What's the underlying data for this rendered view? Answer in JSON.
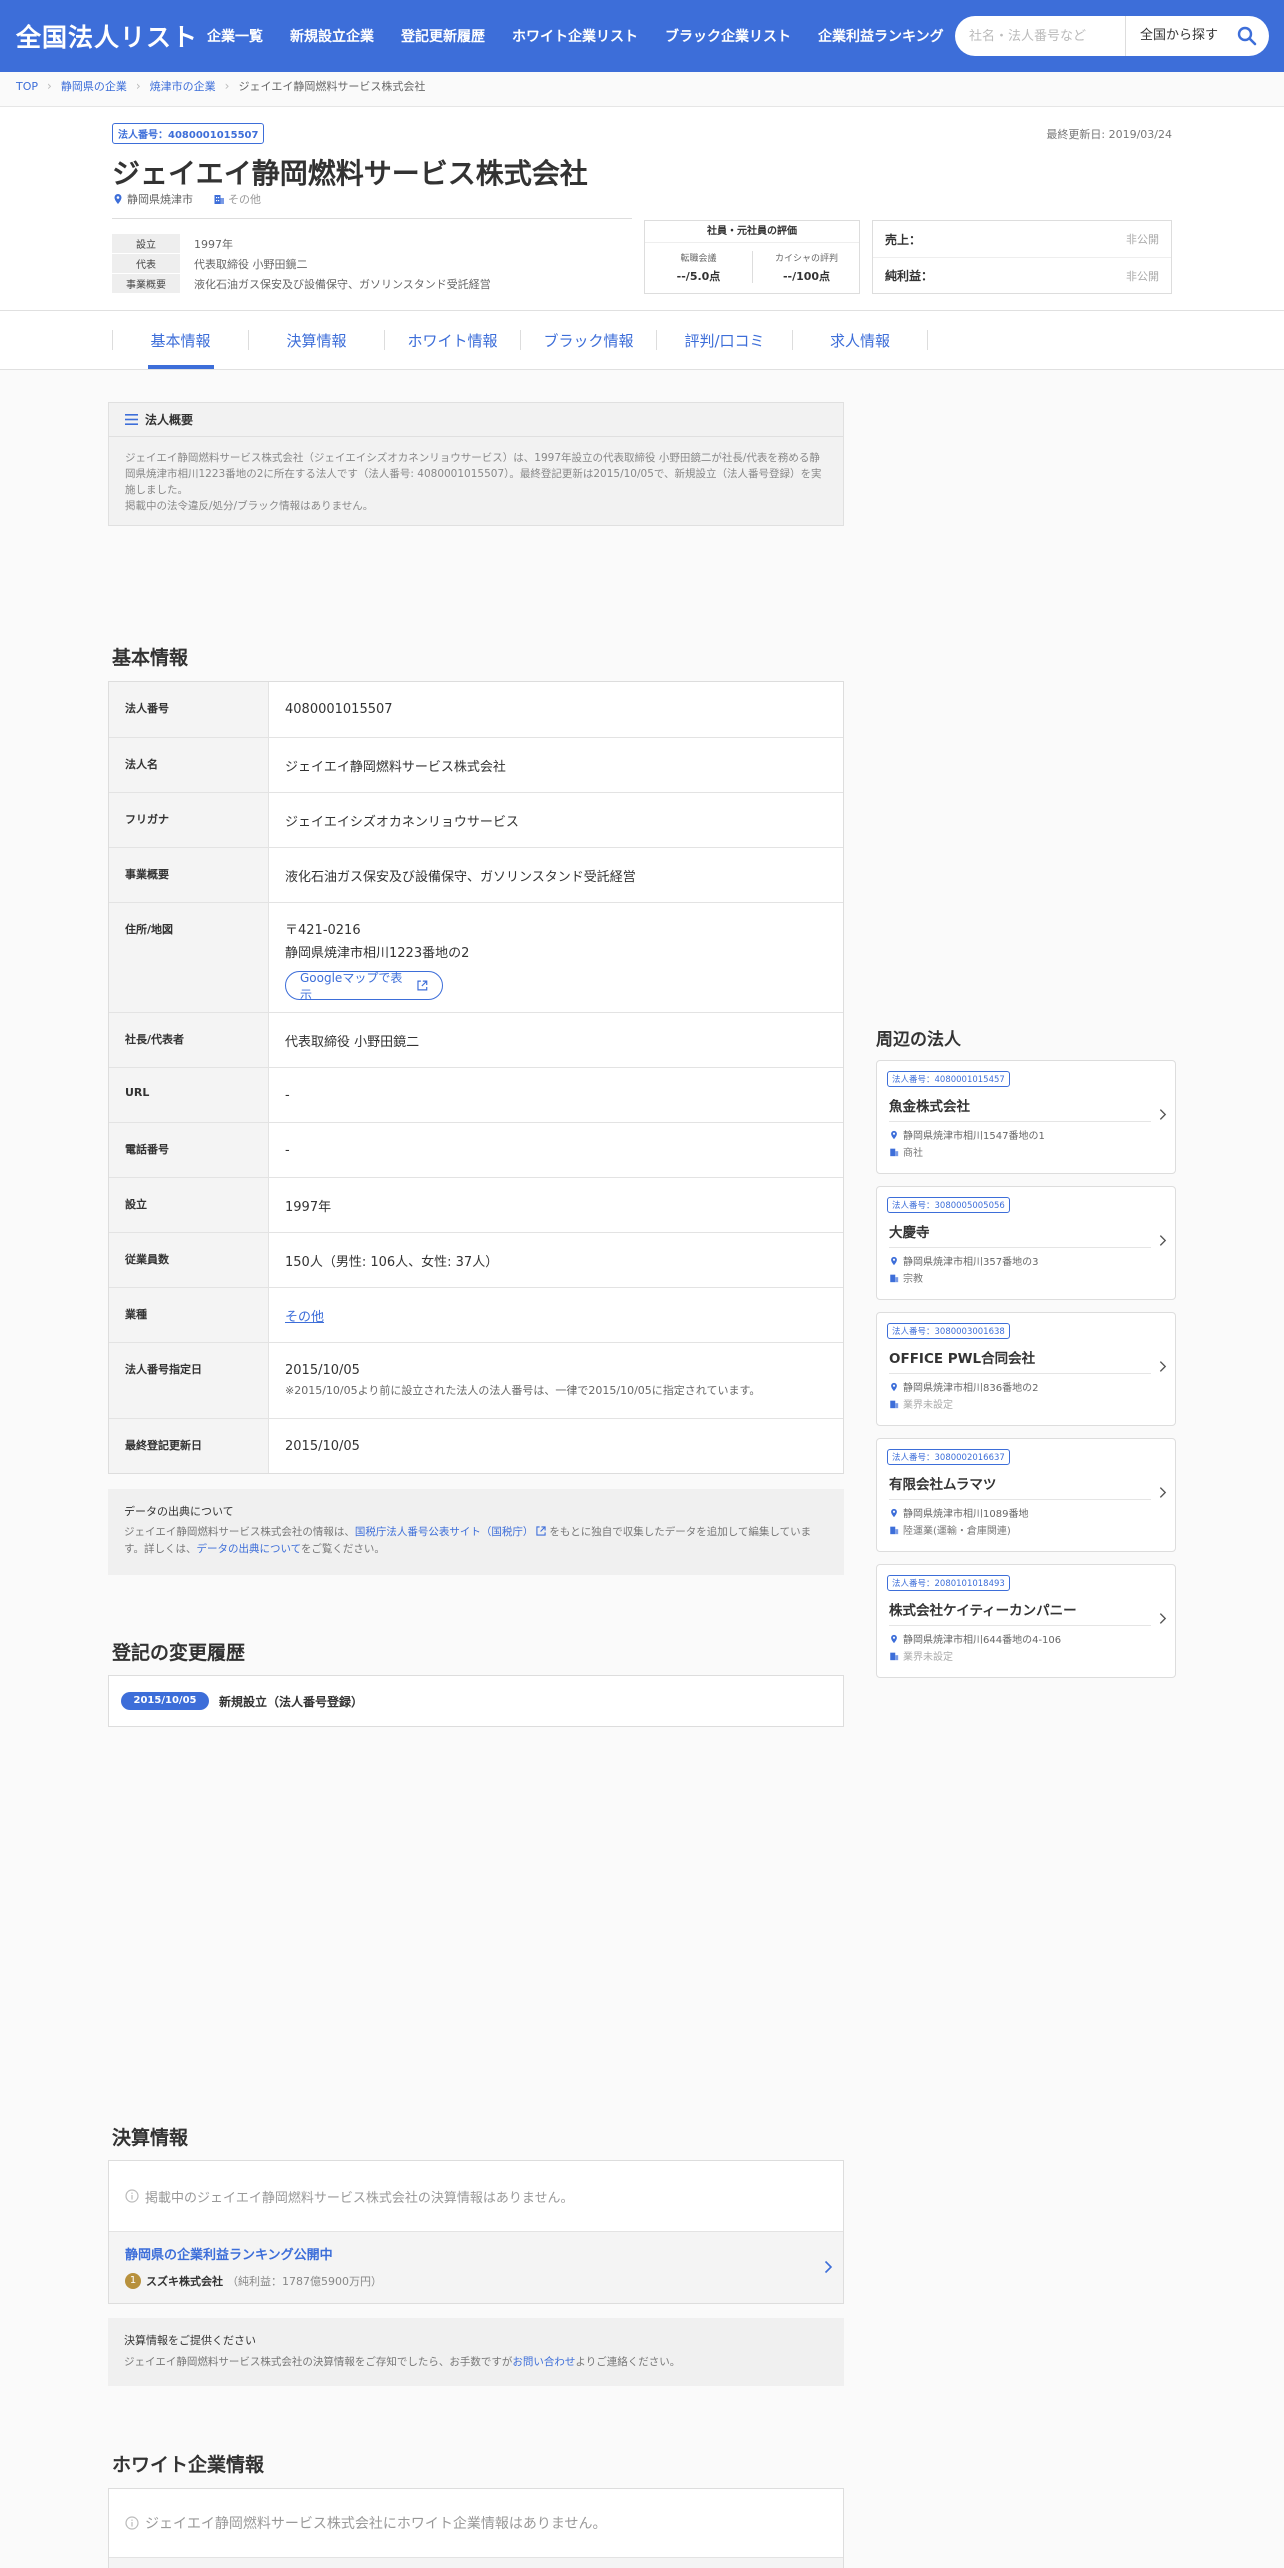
{
  "header": {
    "logo": "全国法人リスト",
    "nav": [
      "企業一覧",
      "新規設立企業",
      "登記更新履歴",
      "ホワイト企業リスト",
      "ブラック企業リスト",
      "企業利益ランキング"
    ],
    "search_placeholder": "社名・法人番号など",
    "search_scope": "全国から探す"
  },
  "breadcrumb": [
    "TOP",
    "静岡県の企業",
    "焼津市の企業",
    "ジェイエイ静岡燃料サービス株式会社"
  ],
  "company": {
    "badge": "法人番号：4080001015507",
    "updated": "最終更新日: 2019/03/24",
    "name": "ジェイエイ静岡燃料サービス株式会社",
    "location": "静岡県焼津市",
    "category": "その他",
    "summary": [
      {
        "k": "設立",
        "v": "1997年"
      },
      {
        "k": "代表",
        "v": "代表取締役 小野田鏡二"
      },
      {
        "k": "事業概要",
        "v": "液化石油ガス保安及び設備保守、ガソリンスタンド受託経営"
      }
    ]
  },
  "evaluation": {
    "title": "社員・元社員の評価",
    "items": [
      {
        "label": "転職会議",
        "value": "--/5.0点"
      },
      {
        "label": "カイシャの評判",
        "value": "--/100点"
      }
    ]
  },
  "finance_summary": [
    {
      "k": "売上：",
      "v": "非公開"
    },
    {
      "k": "純利益：",
      "v": "非公開"
    }
  ],
  "tabs": [
    "基本情報",
    "決算情報",
    "ホワイト情報",
    "ブラック情報",
    "評判/口コミ",
    "求人情報"
  ],
  "overview": {
    "title": "法人概要",
    "text1": "ジェイエイ静岡燃料サービス株式会社（ジェイエイシズオカネンリョウサービス）は、1997年設立の代表取締役 小野田鏡二が社長/代表を務める静岡県焼津市相川1223番地の2に所在する法人です（法人番号: 4080001015507）。最終登記更新は2015/10/05で、新規設立（法人番号登録）を実施しました。",
    "text2": "掲載中の法令違反/処分/ブラック情報はありません。"
  },
  "basic": {
    "title": "基本情報",
    "rows": [
      {
        "k": "法人番号",
        "v": "4080001015507"
      },
      {
        "k": "法人名",
        "v": "ジェイエイ静岡燃料サービス株式会社"
      },
      {
        "k": "フリガナ",
        "v": "ジェイエイシズオカネンリョウサービス"
      },
      {
        "k": "事業概要",
        "v": "液化石油ガス保安及び設備保守、ガソリンスタンド受託経営"
      },
      {
        "k": "住所/地図",
        "v": "〒421-0216",
        "v2": "静岡県焼津市相川1223番地の2",
        "button": "Googleマップで表示"
      },
      {
        "k": "社長/代表者",
        "v": "代表取締役 小野田鏡二"
      },
      {
        "k": "URL",
        "v": "-"
      },
      {
        "k": "電話番号",
        "v": "-"
      },
      {
        "k": "設立",
        "v": "1997年"
      },
      {
        "k": "従業員数",
        "v": "150人（男性: 106人、女性: 37人）"
      },
      {
        "k": "業種",
        "v": "その他"
      },
      {
        "k": "法人番号指定日",
        "v": "2015/10/05",
        "v2": "※2015/10/05より前に設立された法人の法人番号は、一律で2015/10/05に指定されています。"
      },
      {
        "k": "最終登記更新日",
        "v": "2015/10/05"
      }
    ]
  },
  "source": {
    "title": "データの出典について",
    "pre": "ジェイエイ静岡燃料サービス株式会社の情報は、",
    "link1": "国税庁法人番号公表サイト（国税庁）",
    "mid": "をもとに独自で収集したデータを追加して編集しています。詳しくは、",
    "link2": "データの出典について",
    "post": "をご覧ください。"
  },
  "history": {
    "title": "登記の変更履歴",
    "date": "2015/10/05",
    "text": "新規設立（法人番号登録）"
  },
  "settlement": {
    "title": "決算情報",
    "none": "掲載中のジェイエイ静岡燃料サービス株式会社の決算情報はありません。",
    "ranking_title": "静岡県の企業利益ランキング公開中",
    "rank_no": "1",
    "rank_name": "スズキ株式会社",
    "rank_profit": "（純利益：1787億5900万円）",
    "provide_title": "決算情報をご提供ください",
    "provide_pre": "ジェイエイ静岡燃料サービス株式会社の決算情報をご存知でしたら、お手数ですが",
    "provide_link": "お問い合わせ",
    "provide_post": "よりご連絡ください。"
  },
  "white": {
    "title": "ホワイト企業情報",
    "none": "ジェイエイ静岡燃料サービス株式会社にホワイト企業情報はありません。"
  },
  "nearby": {
    "title": "周辺の法人",
    "items": [
      {
        "badge": "法人番号：4080001015457",
        "name": "魚金株式会社",
        "address": "静岡県焼津市相川1547番地の1",
        "industry": "商社",
        "muted": false
      },
      {
        "badge": "法人番号：3080005005056",
        "name": "大慶寺",
        "address": "静岡県焼津市相川357番地の3",
        "industry": "宗教",
        "muted": false
      },
      {
        "badge": "法人番号：3080003001638",
        "name": "OFFICE PWL合同会社",
        "address": "静岡県焼津市相川836番地の2",
        "industry": "業界未設定",
        "muted": true
      },
      {
        "badge": "法人番号：3080002016637",
        "name": "有限会社ムラマツ",
        "address": "静岡県焼津市相川1089番地",
        "industry": "陸運業(運輸・倉庫関連)",
        "muted": false
      },
      {
        "badge": "法人番号：2080101018493",
        "name": "株式会社ケイティーカンパニー",
        "address": "静岡県焼津市相川644番地の4-106",
        "industry": "業界未設定",
        "muted": true
      }
    ]
  },
  "colors": {
    "brand": "#3d6ed9",
    "rank_gold": "#b8913d"
  }
}
